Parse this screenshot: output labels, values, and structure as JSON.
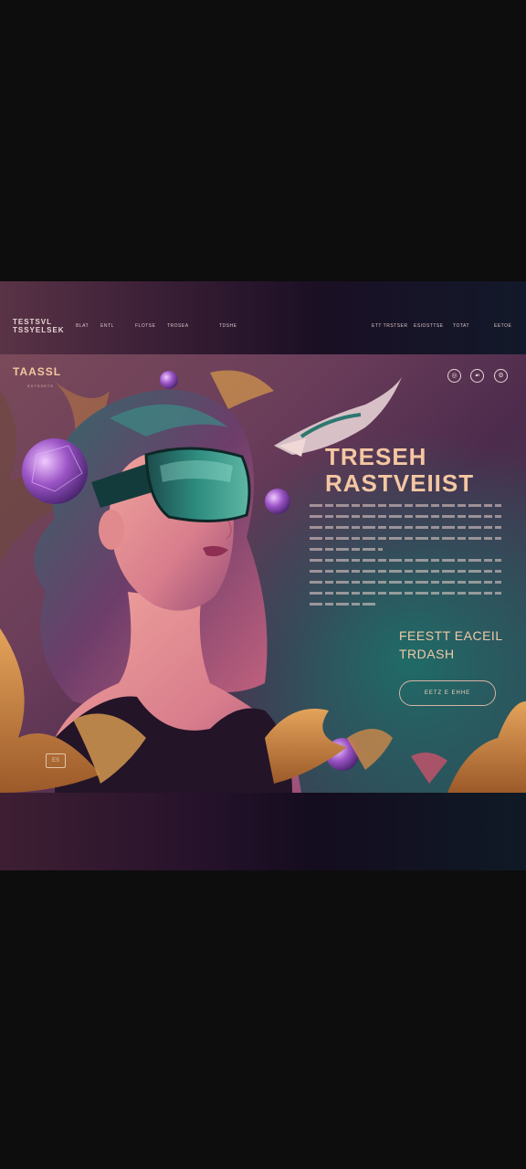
{
  "nav": {
    "logo_line1": "TESTSVL",
    "logo_line2": "TSSYELSEK",
    "links_left": [
      "BLAT",
      "ENTL",
      "FLOTSE",
      "TROSEA",
      "TDSHE"
    ],
    "links_right": [
      "ETT TRSTSER",
      "ESIOSTTSE",
      "TOTAT",
      "EETOE"
    ]
  },
  "hero": {
    "brand": "TAASSL",
    "brand_sub": "ESTSSETS",
    "icons": [
      "compass-icon",
      "leaf-icon",
      "settings-icon"
    ],
    "headline_line1": "TRESEH",
    "headline_line2": "RASTVEIIST",
    "sub_head_line1": "FEESTT EACEIL",
    "sub_head_line2": "TRDASH",
    "cta_label": "EETZ E EHHE",
    "corner_badge": "ES"
  },
  "colors": {
    "accent": "#f4c7a2",
    "teal": "#1f6b67",
    "plum": "#4d2b4c"
  }
}
